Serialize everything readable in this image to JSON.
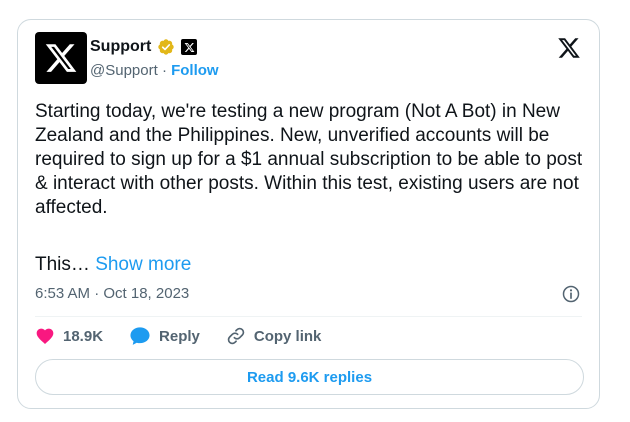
{
  "account": {
    "name": "Support",
    "handle": "@Support",
    "separator": "·",
    "follow_label": "Follow"
  },
  "tweet": {
    "text": "Starting today, we're testing a new program (Not A Bot) in New Zealand and the Philippines. New, unverified accounts will be required to sign up for a $1 annual subscription to be able to post & interact with other posts. Within this test, existing users are not affected.",
    "truncated_text": "This…",
    "show_more_label": "Show more",
    "timestamp": "6:53 AM · Oct 18, 2023"
  },
  "actions": {
    "likes_count": "18.9K",
    "reply_label": "Reply",
    "copy_link_label": "Copy link",
    "read_replies_label": "Read 9.6K replies"
  },
  "icons": {
    "avatar": "x-logo-icon",
    "verified": "verified-badge-icon",
    "affiliate": "x-affiliate-badge-icon",
    "corner": "x-logo-icon",
    "info": "info-icon",
    "like": "heart-icon",
    "reply": "chat-bubble-icon",
    "copy": "link-icon"
  },
  "colors": {
    "accent": "#1d9bf0",
    "like": "#f91880",
    "verified": "#e2b719",
    "text": "#0f1419",
    "muted": "#536471"
  }
}
